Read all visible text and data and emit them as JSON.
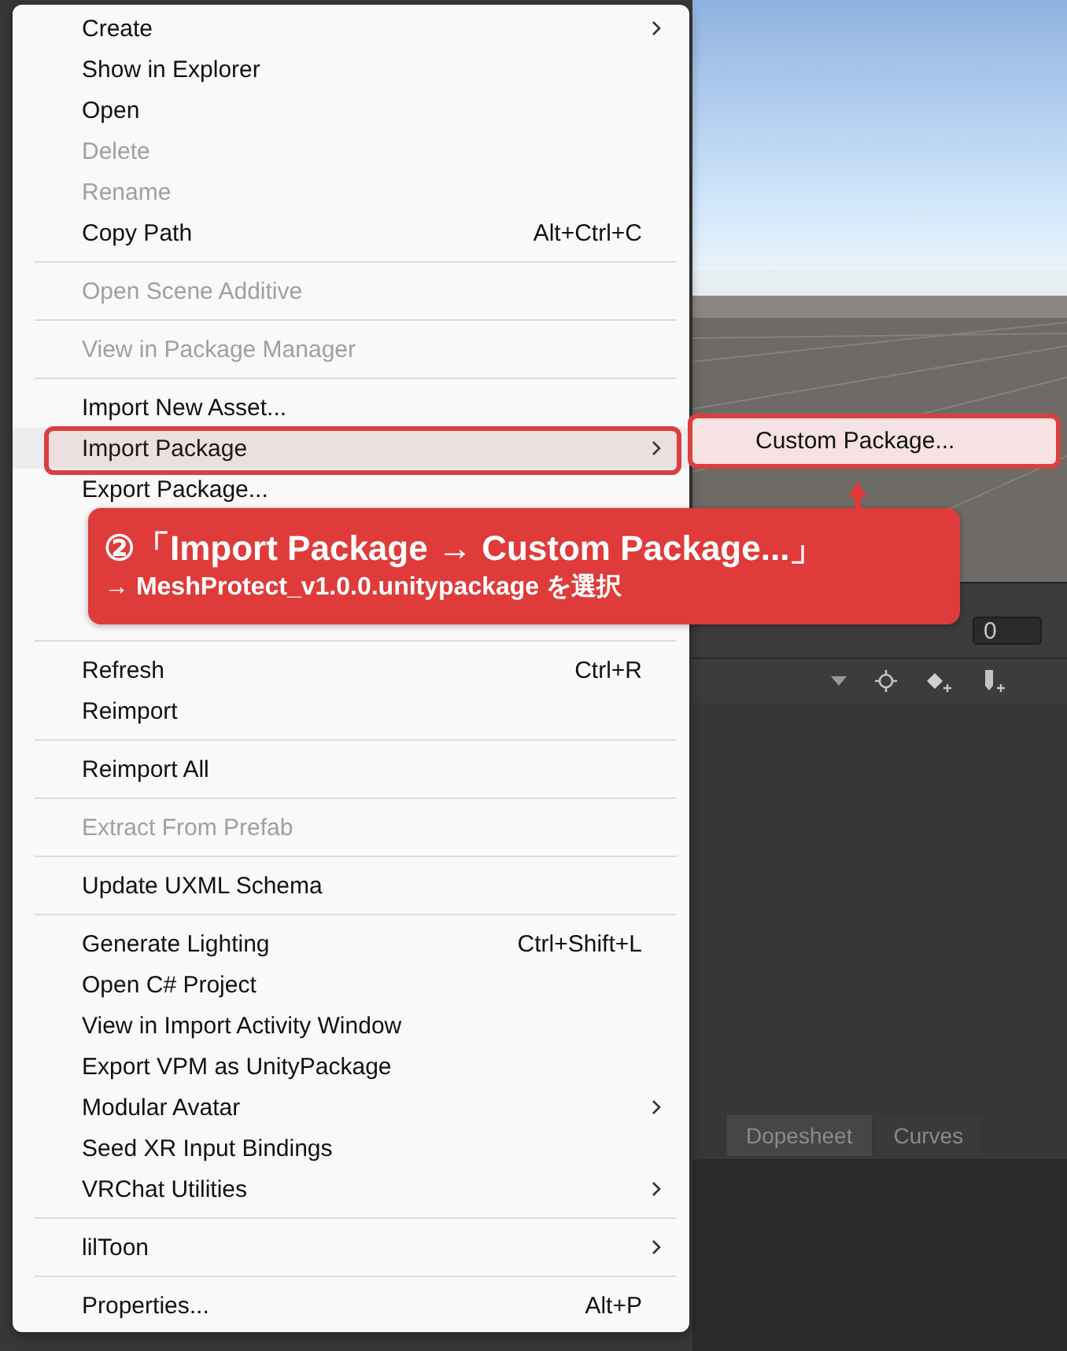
{
  "menu": {
    "items": [
      {
        "kind": "item",
        "label": "Create",
        "submenu": true,
        "disabled": false,
        "selected": false
      },
      {
        "kind": "item",
        "label": "Show in Explorer",
        "submenu": false,
        "disabled": false,
        "selected": false
      },
      {
        "kind": "item",
        "label": "Open",
        "submenu": false,
        "disabled": false,
        "selected": false
      },
      {
        "kind": "item",
        "label": "Delete",
        "submenu": false,
        "disabled": true,
        "selected": false
      },
      {
        "kind": "item",
        "label": "Rename",
        "submenu": false,
        "disabled": true,
        "selected": false
      },
      {
        "kind": "item",
        "label": "Copy Path",
        "shortcut": "Alt+Ctrl+C",
        "submenu": false,
        "disabled": false,
        "selected": false
      },
      {
        "kind": "separator"
      },
      {
        "kind": "item",
        "label": "Open Scene Additive",
        "submenu": false,
        "disabled": true,
        "selected": false
      },
      {
        "kind": "separator"
      },
      {
        "kind": "item",
        "label": "View in Package Manager",
        "submenu": false,
        "disabled": true,
        "selected": false
      },
      {
        "kind": "separator"
      },
      {
        "kind": "item",
        "label": "Import New Asset...",
        "submenu": false,
        "disabled": false,
        "selected": false
      },
      {
        "kind": "item",
        "label": "Import Package",
        "submenu": true,
        "disabled": false,
        "selected": true
      },
      {
        "kind": "item",
        "label": "Export Package...",
        "submenu": false,
        "disabled": false,
        "selected": false
      },
      {
        "kind": "callout",
        "title": "②「Import Package → Custom Package...」",
        "subtitle": "→ MeshProtect_v1.0.0.unitypackage を選択"
      },
      {
        "kind": "separator"
      },
      {
        "kind": "item",
        "label": "Refresh",
        "shortcut": "Ctrl+R",
        "submenu": false,
        "disabled": false,
        "selected": false
      },
      {
        "kind": "item",
        "label": "Reimport",
        "submenu": false,
        "disabled": false,
        "selected": false
      },
      {
        "kind": "separator"
      },
      {
        "kind": "item",
        "label": "Reimport All",
        "submenu": false,
        "disabled": false,
        "selected": false
      },
      {
        "kind": "separator"
      },
      {
        "kind": "item",
        "label": "Extract From Prefab",
        "submenu": false,
        "disabled": true,
        "selected": false
      },
      {
        "kind": "separator"
      },
      {
        "kind": "item",
        "label": "Update UXML Schema",
        "submenu": false,
        "disabled": false,
        "selected": false
      },
      {
        "kind": "separator"
      },
      {
        "kind": "item",
        "label": "Generate Lighting",
        "shortcut": "Ctrl+Shift+L",
        "submenu": false,
        "disabled": false,
        "selected": false
      },
      {
        "kind": "item",
        "label": "Open C# Project",
        "submenu": false,
        "disabled": false,
        "selected": false
      },
      {
        "kind": "item",
        "label": "View in Import Activity Window",
        "submenu": false,
        "disabled": false,
        "selected": false
      },
      {
        "kind": "item",
        "label": "Export VPM as UnityPackage",
        "submenu": false,
        "disabled": false,
        "selected": false
      },
      {
        "kind": "item",
        "label": "Modular Avatar",
        "submenu": true,
        "disabled": false,
        "selected": false
      },
      {
        "kind": "item",
        "label": "Seed XR Input Bindings",
        "submenu": false,
        "disabled": false,
        "selected": false
      },
      {
        "kind": "item",
        "label": "VRChat Utilities",
        "submenu": true,
        "disabled": false,
        "selected": false
      },
      {
        "kind": "separator"
      },
      {
        "kind": "item",
        "label": "lilToon",
        "submenu": true,
        "disabled": false,
        "selected": false
      },
      {
        "kind": "separator"
      },
      {
        "kind": "item",
        "label": "Properties...",
        "shortcut": "Alt+P",
        "submenu": false,
        "disabled": false,
        "selected": false
      }
    ]
  },
  "submenu": {
    "items": [
      {
        "label": "Custom Package...",
        "selected": true
      }
    ]
  },
  "timeline": {
    "frame_field": "0",
    "tabs": [
      {
        "label": "Dopesheet",
        "selected": true
      },
      {
        "label": "Curves",
        "selected": false
      }
    ]
  }
}
